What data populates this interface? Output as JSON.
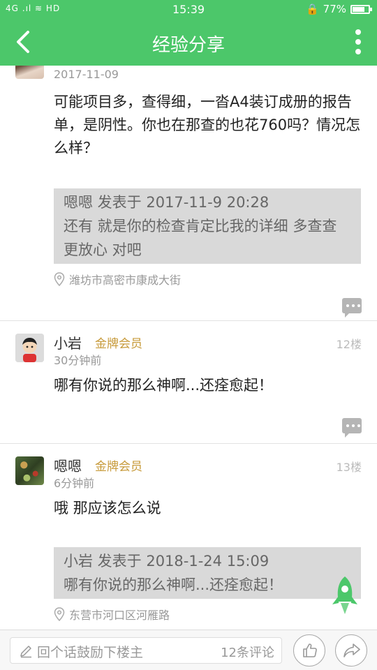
{
  "status": {
    "signal": "4G .ıl ≋ HD",
    "time": "15:39",
    "battery": "77%",
    "battery_level": 0.77
  },
  "header": {
    "title": "经验分享"
  },
  "comments": [
    {
      "time": "2017-11-09",
      "text": "可能项目多，查得细，一沓A4装订成册的报告单，是阴性。你也在那查的也花760吗？情况怎么样？",
      "quote_header": "嗯嗯 发表于 2017-11-9 20:28",
      "quote_text": "还有 就是你的检查肯定比我的详细 多查查更放心 对吧",
      "location": "潍坊市高密市康成大街"
    },
    {
      "name": "小岩",
      "badge": "金牌会员",
      "floor": "12楼",
      "time": "30分钟前",
      "text": "哪有你说的那么神啊...还痊愈起！"
    },
    {
      "name": "嗯嗯",
      "badge": "金牌会员",
      "floor": "13楼",
      "time": "6分钟前",
      "text": "哦 那应该怎么说",
      "quote_header": "小岩 发表于 2018-1-24 15:09",
      "quote_text": "哪有你说的那么神啊...还痊愈起！",
      "location": "东营市河口区河雁路"
    }
  ],
  "bottom": {
    "input_placeholder": "回个话鼓励下楼主",
    "comment_count": "12条评论"
  },
  "colors": {
    "brand_green": "#4cc76a",
    "badge_gold": "#c79a3a"
  }
}
